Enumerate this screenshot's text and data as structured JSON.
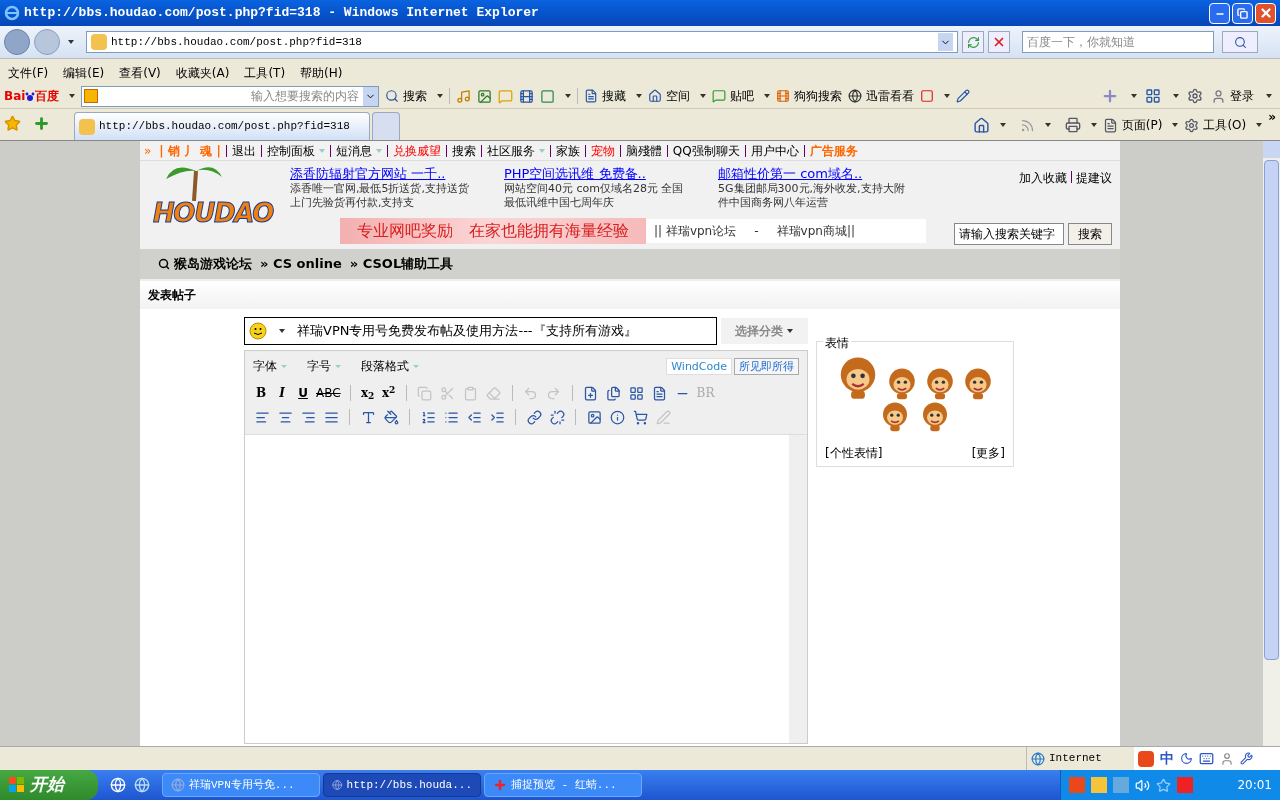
{
  "window": {
    "title": "http://bbs.houdao.com/post.php?fid=318 - Windows Internet Explorer"
  },
  "address_bar": {
    "url": "http://bbs.houdao.com/post.php?fid=318",
    "search_placeholder": "百度一下，你就知道"
  },
  "menu": [
    "文件(F)",
    "编辑(E)",
    "查看(V)",
    "收藏夹(A)",
    "工具(T)",
    "帮助(H)"
  ],
  "baidu_toolbar": {
    "logo_left": "Bai",
    "logo_right": "百度",
    "placeholder": "输入想要搜索的内容",
    "search_button": "搜索",
    "items": [
      {
        "kind": "menu",
        "label": "搜藏"
      },
      {
        "kind": "menu",
        "label": "空间"
      },
      {
        "kind": "menu",
        "label": "贴吧"
      },
      {
        "kind": "plain",
        "label": "狗狗搜索"
      },
      {
        "kind": "plain",
        "label": "迅雷看看"
      }
    ],
    "login": "登录"
  },
  "tabs": [
    {
      "label": "http://bbs.houdao.com/post.php?fid=318",
      "selected": true
    },
    {
      "selected": false
    }
  ],
  "command_bar": {
    "page": "页面(P)",
    "tools": "工具(O)",
    "more": "»"
  },
  "forum_nav": [
    {
      "label": "»",
      "kind": "arrow",
      "dropdown": false
    },
    {
      "label": "| 销 丿 魂 |",
      "kind": "accent",
      "dropdown": false
    },
    {
      "label": "退出",
      "kind": "plain",
      "dropdown": false
    },
    {
      "label": "控制面板",
      "kind": "plain",
      "dropdown": true
    },
    {
      "label": "短消息",
      "kind": "plain",
      "dropdown": true
    },
    {
      "label": "兑换威望",
      "kind": "hot",
      "dropdown": false
    },
    {
      "label": "搜索",
      "kind": "plain",
      "dropdown": false
    },
    {
      "label": "社区服务",
      "kind": "plain",
      "dropdown": true
    },
    {
      "label": "家族",
      "kind": "plain",
      "dropdown": false
    },
    {
      "label": "宠物",
      "kind": "hot",
      "dropdown": false
    },
    {
      "label": "脑殘體",
      "kind": "plain",
      "dropdown": false
    },
    {
      "label": "QQ强制聊天",
      "kind": "plain",
      "dropdown": false
    },
    {
      "label": "用户中心",
      "kind": "plain",
      "dropdown": false
    },
    {
      "label": "广告服务",
      "kind": "accent",
      "dropdown": false
    }
  ],
  "header": {
    "logo_text": "HOUDAO",
    "ads": [
      {
        "title": "添香防辐射官方网站  一千..",
        "lines": [
          "添香唯一官网,最低5折送货,支持送货",
          "上门先验货再付款,支持支"
        ]
      },
      {
        "title": "PHP空间选讯维  免费备..",
        "lines": [
          "网站空间40元  com仅域名28元  全国",
          "最低讯维中国七周年庆"
        ]
      },
      {
        "title": "邮箱性价第一  com域名..",
        "lines": [
          "5G集团邮局300元,海外收发,支持大附",
          "件中国商务网八年运营"
        ]
      }
    ],
    "banner": "专业网吧奖励　在家也能拥有海量经验",
    "links": [
      "|| 祥瑞vpn论坛",
      "-",
      "祥瑞vpn商城||"
    ],
    "top_links": [
      "加入收藏",
      "提建议"
    ],
    "search_value": "请输入搜索关键字",
    "search_button": "搜索"
  },
  "breadcrumb": [
    "猴岛游戏论坛",
    "» CS online",
    "» CSOL辅助工具"
  ],
  "section_title": "发表帖子",
  "post_form": {
    "subject": "祥瑞VPN专用号免费发布帖及使用方法---『支持所有游戏』",
    "category": "选择分类",
    "font_menus": [
      "字体",
      "字号",
      "段落格式"
    ],
    "modes": [
      {
        "label": "WindCode",
        "selected": true
      },
      {
        "label": "所见即所得",
        "selected": false
      }
    ],
    "toolbar_row1": [
      {
        "kind": "text",
        "label": "B",
        "disabled": false
      },
      {
        "kind": "text",
        "label": "I",
        "disabled": false
      },
      {
        "kind": "text",
        "label": "U",
        "disabled": false
      },
      {
        "kind": "text",
        "label": "ABC",
        "disabled": false
      },
      {
        "kind": "sep"
      },
      {
        "kind": "text",
        "label": "x$_{2}$",
        "disabled": false
      },
      {
        "kind": "text",
        "label": "x$^{2}$",
        "disabled": false
      },
      {
        "kind": "sep"
      },
      {
        "kind": "icon",
        "disabled": true
      },
      {
        "kind": "icon",
        "disabled": true
      },
      {
        "kind": "icon",
        "disabled": true
      },
      {
        "kind": "icon",
        "disabled": true
      },
      {
        "kind": "sep"
      },
      {
        "kind": "icon",
        "disabled": true
      },
      {
        "kind": "icon",
        "disabled": true
      },
      {
        "kind": "sep"
      },
      {
        "kind": "icon",
        "disabled": false
      },
      {
        "kind": "icon",
        "disabled": false
      },
      {
        "kind": "icon",
        "disabled": false
      },
      {
        "kind": "icon",
        "disabled": false
      },
      {
        "kind": "icon",
        "disabled": false
      },
      {
        "kind": "text",
        "label": "BR",
        "disabled": true
      }
    ],
    "toolbar_row2": [
      {
        "kind": "icon",
        "disabled": false
      },
      {
        "kind": "icon",
        "disabled": false
      },
      {
        "kind": "icon",
        "disabled": false
      },
      {
        "kind": "icon",
        "disabled": false
      },
      {
        "kind": "sep"
      },
      {
        "kind": "icon",
        "disabled": false
      },
      {
        "kind": "icon",
        "disabled": false
      },
      {
        "kind": "sep"
      },
      {
        "kind": "icon",
        "disabled": false
      },
      {
        "kind": "icon",
        "disabled": false
      },
      {
        "kind": "icon",
        "disabled": false
      },
      {
        "kind": "icon",
        "disabled": false
      },
      {
        "kind": "sep"
      },
      {
        "kind": "icon",
        "disabled": false
      },
      {
        "kind": "icon",
        "disabled": false
      },
      {
        "kind": "sep"
      },
      {
        "kind": "icon",
        "disabled": false
      },
      {
        "kind": "icon",
        "disabled": false
      },
      {
        "kind": "icon",
        "disabled": false
      },
      {
        "kind": "icon",
        "disabled": true
      }
    ]
  },
  "smilies": {
    "legend": "表情",
    "personal": "[个性表情]",
    "more": "[更多]"
  },
  "status_bar": {
    "zone": "Internet"
  },
  "taskbar": {
    "start": "开始",
    "tasks": [
      {
        "label": "祥瑞VPN专用号免...",
        "kind": "ie",
        "selected": false
      },
      {
        "label": "http://bbs.houda...",
        "kind": "ie",
        "selected": true
      },
      {
        "label": "捕捉预览 - 红蜻...",
        "kind": "capture",
        "selected": false
      }
    ],
    "ime": "中",
    "time": "20:01"
  }
}
